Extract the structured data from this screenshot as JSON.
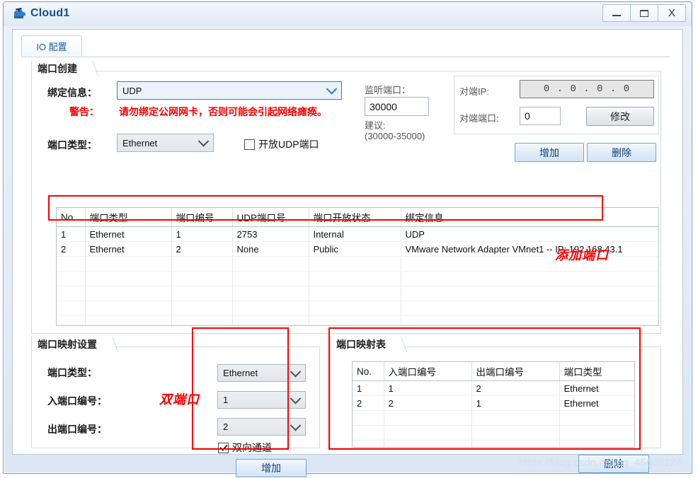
{
  "window": {
    "title": "Cloud1",
    "icon": "cloud-icon",
    "controls": {
      "minimize": "—",
      "maximize": "□",
      "close": "X"
    }
  },
  "tabs": [
    {
      "label": "IO 配置",
      "active": true
    }
  ],
  "port_create": {
    "group_title": "端口创建",
    "bind_info_label": "绑定信息：",
    "bind_info_value": "UDP",
    "warning_label": "警告：",
    "warning_text": "请勿绑定公网网卡，否则可能会引起网络瘫痪。",
    "port_type_label": "端口类型：",
    "port_type_value": "Ethernet",
    "open_udp_label": "开放UDP端口",
    "open_udp_checked": false,
    "listen_port_label": "监听端口：",
    "listen_port_value": "30000",
    "suggest_label": "建议:",
    "suggest_range": "(30000-35000)",
    "peer_ip_label": "对端IP:",
    "peer_ip_value": "0 . 0 . 0 . 0",
    "peer_port_label": "对端端口:",
    "peer_port_value": "0",
    "modify_button": "修改",
    "add_button": "增加",
    "delete_button": "删除"
  },
  "port_table": {
    "columns": [
      "No.",
      "端口类型",
      "端口编号",
      "UDP端口号",
      "端口开放状态",
      "绑定信息"
    ],
    "rows": [
      [
        "1",
        "Ethernet",
        "1",
        "2753",
        "Internal",
        "UDP"
      ],
      [
        "2",
        "Ethernet",
        "2",
        "None",
        "Public",
        "VMware Network Adapter VMnet1 -- IP: 192.168.43.1"
      ]
    ],
    "empty_rows": 5
  },
  "mapping_settings": {
    "group_title": "端口映射设置",
    "port_type_label": "端口类型：",
    "in_port_label": "入端口编号：",
    "out_port_label": "出端口编号：",
    "port_type_value": "Ethernet",
    "in_port_value": "1",
    "out_port_value": "2",
    "bidirectional_label": "双向通道",
    "bidirectional_checked": true,
    "add_button": "增加"
  },
  "mapping_table": {
    "group_title": "端口映射表",
    "columns": [
      "No.",
      "入端口编号",
      "出端口编号",
      "端口类型"
    ],
    "rows": [
      [
        "1",
        "1",
        "2",
        "Ethernet"
      ],
      [
        "2",
        "2",
        "1",
        "Ethernet"
      ]
    ],
    "empty_rows": 3,
    "delete_button": "删除"
  },
  "annotations": [
    {
      "text": "添加端口",
      "name": "annotation-add-port"
    },
    {
      "text": "双端口",
      "name": "annotation-dual-port"
    }
  ],
  "watermark": "https://blog.csdn.net/qq_45668124",
  "colors": {
    "accent": "#1b4f8a",
    "warning": "#ff0000",
    "annotation": "#ff0000",
    "combo_focus_border": "#2a7fd4",
    "window_border": "#7d9db8"
  }
}
